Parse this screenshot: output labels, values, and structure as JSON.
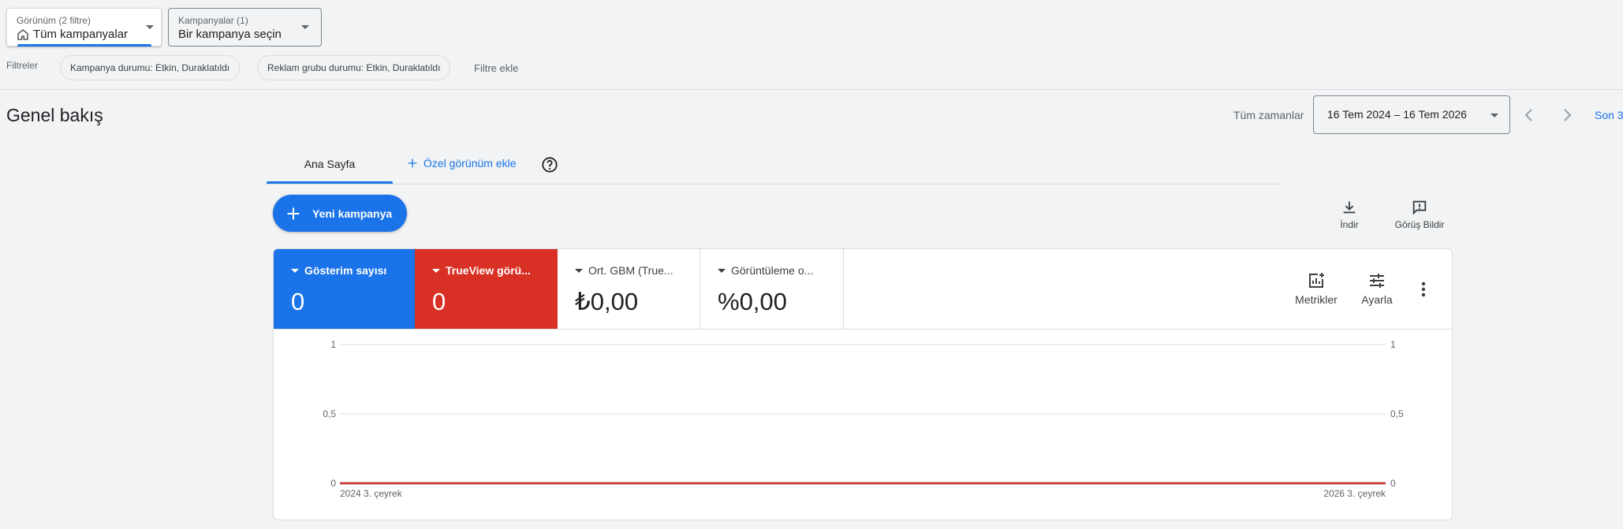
{
  "view_selector": {
    "label": "Görünüm (2 filtre)",
    "value": "Tüm kampanyalar",
    "icon": "home-icon"
  },
  "campaign_selector": {
    "label": "Kampanyalar (1)",
    "value": "Bir kampanya seçin"
  },
  "filters": {
    "label": "Filtreler",
    "chips": [
      "Kampanya durumu: Etkin, Duraklatıldı",
      "Reklam grubu durumu: Etkin, Duraklatıldı"
    ],
    "add_label": "Filtre ekle"
  },
  "overview": {
    "title": "Genel bakış",
    "range_label": "Tüm zamanlar",
    "date_range": "16 Tem 2024 – 16 Tem 2026",
    "truncated_link": "Son 3"
  },
  "tabs": {
    "home": "Ana Sayfa",
    "add_custom": "Özel görünüm ekle"
  },
  "new_campaign": "Yeni kampanya",
  "tools": {
    "download": "İndir",
    "feedback": "Görüş Bildir",
    "metrics": "Metrikler",
    "adjust": "Ayarla"
  },
  "metrics": [
    {
      "name": "Gösterim sayısı",
      "value": "0",
      "color": "#1a73e8"
    },
    {
      "name": "TrueView görü...",
      "value": "0",
      "color": "#d93025"
    },
    {
      "name": "Ort. GBM (True...",
      "value": "₺0,00"
    },
    {
      "name": "Görüntüleme o...",
      "value": "%0,00"
    }
  ],
  "chart_data": {
    "type": "line",
    "x": [
      "2024 3. çeyrek",
      "2026 3. çeyrek"
    ],
    "series": [
      {
        "values": [
          0,
          0
        ],
        "color": "#1a73e8"
      },
      {
        "values": [
          0,
          0
        ],
        "color": "#d93025"
      }
    ],
    "y_ticks": [
      "0",
      "0,5",
      "1"
    ],
    "ylim": [
      0,
      1
    ],
    "y2_ticks": [
      "0",
      "0,5",
      "1"
    ],
    "grid": true
  }
}
